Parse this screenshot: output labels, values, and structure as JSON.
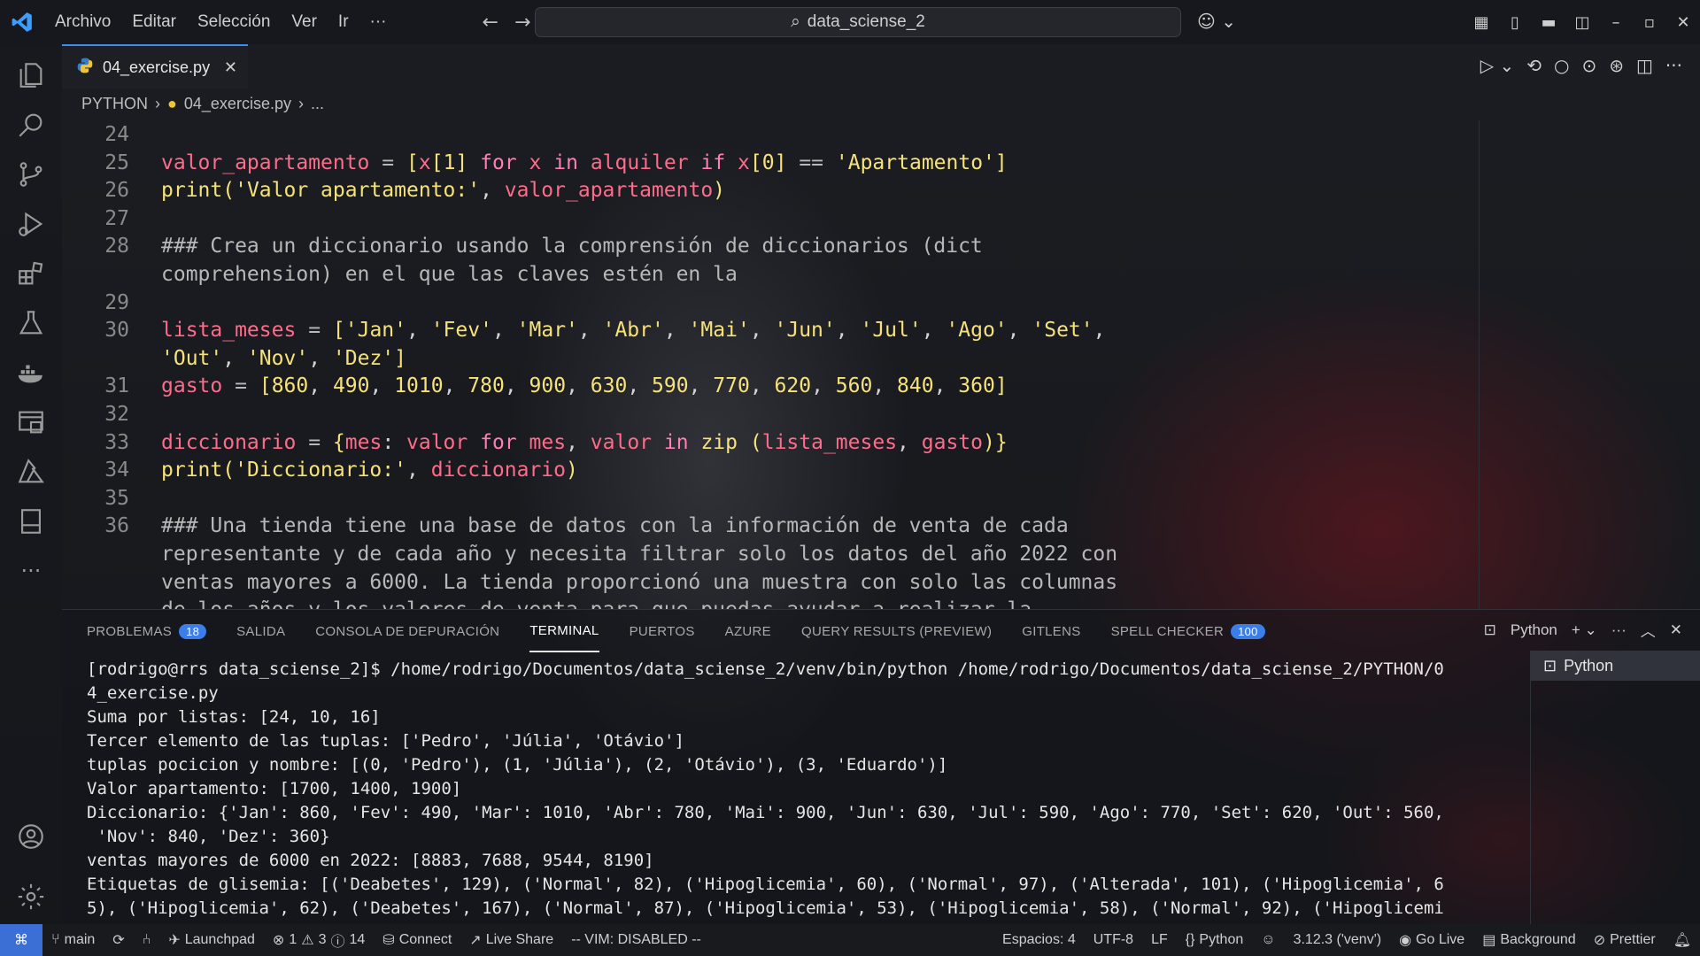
{
  "titlebar": {
    "menu": [
      "Archivo",
      "Editar",
      "Selección",
      "Ver",
      "Ir",
      "···"
    ],
    "search": "data_sciense_2"
  },
  "tab": {
    "filename": "04_exercise.py"
  },
  "breadcrumb": {
    "folder": "PYTHON",
    "file": "04_exercise.py",
    "rest": "..."
  },
  "editor": {
    "lines": [
      {
        "n": "24",
        "html": ""
      },
      {
        "n": "25",
        "html": "<span class='var'>valor_apartamento</span> <span class='op'>=</span> <span class='str'>[</span><span class='var'>x</span><span class='str'>[</span><span class='num'>1</span><span class='str'>]</span> <span class='kw'>for</span> <span class='var'>x</span> <span class='kw'>in</span> <span class='var'>alquiler</span> <span class='kw'>if</span> <span class='var'>x</span><span class='str'>[</span><span class='num'>0</span><span class='str'>]</span> <span class='op'>==</span> <span class='str'>'Apartamento']</span>"
      },
      {
        "n": "26",
        "html": "<span class='fn'>print</span><span class='str'>(</span><span class='str'>'Valor apartamento:'</span>, <span class='var'>valor_apartamento</span><span class='str'>)</span>"
      },
      {
        "n": "27",
        "html": ""
      },
      {
        "n": "28",
        "html": "<span class='cm'>### Crea un diccionario usando la comprensión de diccionarios (dict</span>"
      },
      {
        "n": "",
        "html": "<span class='cm'>comprehension) en el que las claves estén en la</span>"
      },
      {
        "n": "29",
        "html": ""
      },
      {
        "n": "30",
        "html": "<span class='var'>lista_meses</span> <span class='op'>=</span> <span class='str'>['Jan'</span>, <span class='str'>'Fev'</span>, <span class='str'>'Mar'</span>, <span class='str'>'Abr'</span>, <span class='str'>'Mai'</span>, <span class='str'>'Jun'</span>, <span class='str'>'Jul'</span>, <span class='str'>'Ago'</span>, <span class='str'>'Set'</span>,"
      },
      {
        "n": "",
        "html": "<span class='str'>'Out'</span>, <span class='str'>'Nov'</span>, <span class='str'>'Dez']</span>"
      },
      {
        "n": "31",
        "html": "<span class='var'>gasto</span> <span class='op'>=</span> <span class='str'>[</span><span class='num'>860</span>, <span class='num'>490</span>, <span class='num'>1010</span>, <span class='num'>780</span>, <span class='num'>900</span>, <span class='num'>630</span>, <span class='num'>590</span>, <span class='num'>770</span>, <span class='num'>620</span>, <span class='num'>560</span>, <span class='num'>840</span>, <span class='num'>360</span><span class='str'>]</span>"
      },
      {
        "n": "32",
        "html": ""
      },
      {
        "n": "33",
        "html": "<span class='var'>diccionario</span> <span class='op'>=</span> <span class='str'>{</span><span class='var'>mes</span>: <span class='var'>valor</span> <span class='kw'>for</span> <span class='var'>mes</span>, <span class='var'>valor</span> <span class='kw'>in</span> <span class='fn'>zip</span> <span class='str'>(</span><span class='var'>lista_meses</span>, <span class='var'>gasto</span><span class='str'>)}</span>"
      },
      {
        "n": "34",
        "html": "<span class='fn'>print</span><span class='str'>(</span><span class='str'>'Diccionario:'</span>, <span class='var'>diccionario</span><span class='str'>)</span>"
      },
      {
        "n": "35",
        "html": ""
      },
      {
        "n": "36",
        "html": "<span class='cm'>### Una tienda tiene una base de datos con la información de venta de cada</span>"
      },
      {
        "n": "",
        "html": "<span class='cm'>representante y de cada año y necesita filtrar solo los datos del año 2022 con</span>"
      },
      {
        "n": "",
        "html": "<span class='cm'>ventas mayores a 6000. La tienda proporcionó una muestra con solo las columnas</span>"
      },
      {
        "n": "",
        "html": "<span class='cm'>de los años y los valores de venta para que puedas ayudar a realizar la</span>"
      }
    ]
  },
  "panel": {
    "tabs": [
      {
        "label": "PROBLEMAS",
        "badge": "18"
      },
      {
        "label": "SALIDA",
        "badge": ""
      },
      {
        "label": "CONSOLA DE DEPURACIÓN",
        "badge": ""
      },
      {
        "label": "TERMINAL",
        "badge": "",
        "active": true
      },
      {
        "label": "PUERTOS",
        "badge": ""
      },
      {
        "label": "AZURE",
        "badge": ""
      },
      {
        "label": "QUERY RESULTS (PREVIEW)",
        "badge": ""
      },
      {
        "label": "GITLENS",
        "badge": ""
      },
      {
        "label": "SPELL CHECKER",
        "badge": "100"
      }
    ],
    "terminal_name": "Python",
    "terminal_list_item": "Python",
    "terminal_lines": [
      "[rodrigo@rrs data_sciense_2]$ /home/rodrigo/Documentos/data_sciense_2/venv/bin/python /home/rodrigo/Documentos/data_sciense_2/PYTHON/0",
      "4_exercise.py",
      "Suma por listas: [24, 10, 16]",
      "Tercer elemento de las tuplas: ['Pedro', 'Júlia', 'Otávio']",
      "tuplas pocicion y nombre: [(0, 'Pedro'), (1, 'Júlia'), (2, 'Otávio'), (3, 'Eduardo')]",
      "Valor apartamento: [1700, 1400, 1900]",
      "Diccionario: {'Jan': 860, 'Fev': 490, 'Mar': 1010, 'Abr': 780, 'Mai': 900, 'Jun': 630, 'Jul': 590, 'Ago': 770, 'Set': 620, 'Out': 560,",
      " 'Nov': 840, 'Dez': 360}",
      "ventas mayores de 6000 en 2022: [8883, 7688, 9544, 8190]",
      "Etiquetas de glisemia: [('Deabetes', 129), ('Normal', 82), ('Hipoglicemia', 60), ('Normal', 97), ('Alterada', 101), ('Hipoglicemia', 6",
      "5), ('Hipoglicemia', 62), ('Deabetes', 167), ('Normal', 87), ('Hipoglicemia', 53), ('Hipoglicemia', 58), ('Normal', 92), ('Hipoglicemi"
    ]
  },
  "statusbar": {
    "branch": "main",
    "launchpad": "Launchpad",
    "errors": "1",
    "warnings": "3",
    "infos": "14",
    "connect": "Connect",
    "liveshare": "Live Share",
    "vim": "-- VIM: DISABLED --",
    "spaces": "Espacios: 4",
    "encoding": "UTF-8",
    "eol": "LF",
    "language": "Python",
    "interpreter": "3.12.3 ('venv')",
    "golive": "Go Live",
    "background": "Background",
    "prettier": "Prettier"
  }
}
